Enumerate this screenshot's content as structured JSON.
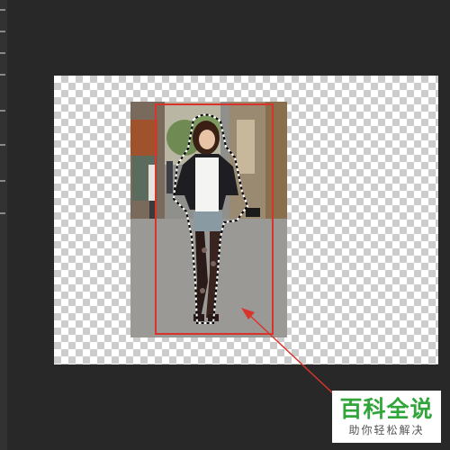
{
  "watermark": {
    "title": "百科全说",
    "subtitle": "助你轻松解决",
    "title_color": "#2fa53a"
  },
  "annotation": {
    "color": "#d9342c"
  },
  "canvas": {
    "background": "transparent-checkerboard"
  },
  "selection": {
    "style": "marching-ants"
  },
  "toolbar": {
    "icons": [
      "move-tool-icon",
      "marquee-tool-icon",
      "lasso-tool-icon",
      "quick-select-tool-icon",
      "crop-tool-icon",
      "eyedropper-tool-icon",
      "brush-tool-icon"
    ]
  }
}
